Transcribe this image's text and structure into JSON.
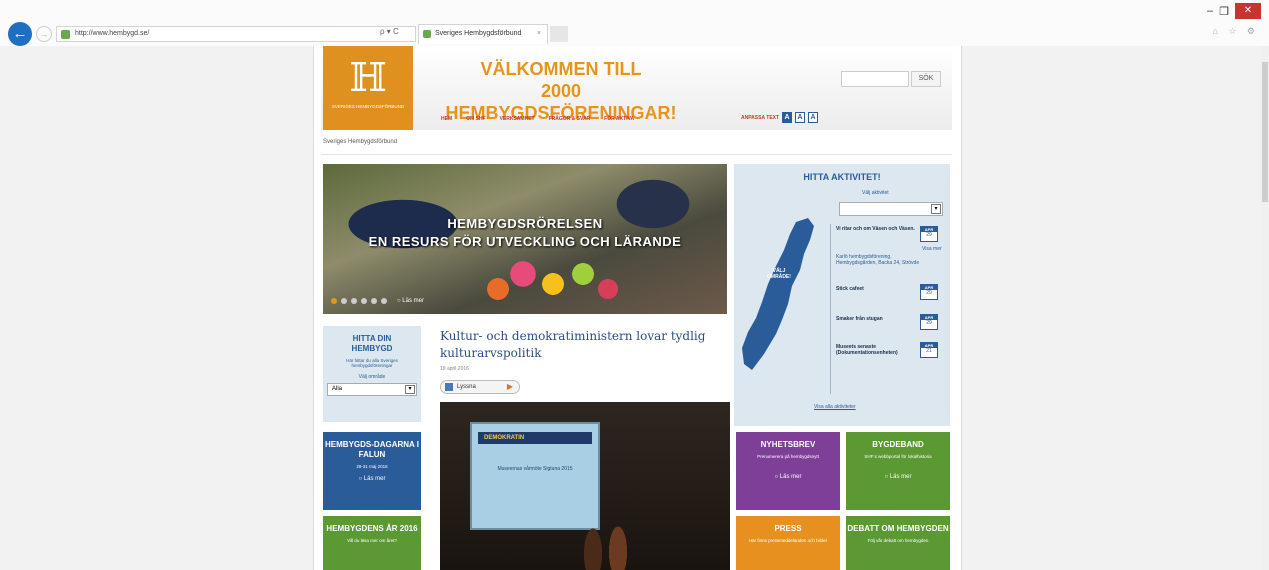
{
  "browser": {
    "url": "http://www.hembygd.se/",
    "tab_title": "Sveriges Hembygdsförbund",
    "tab_close": "×",
    "addr_tools": "ρ ▾ C",
    "window_controls": [
      "–",
      "❐",
      "✕"
    ],
    "side_icons": "⌂ ☆ ⚙"
  },
  "header": {
    "logo_text": "SVERIGES HEMBYGDSFÖRBUND",
    "welcome_line1": "VÄLKOMMEN TILL",
    "welcome_line2": "2000 HEMBYGDSFÖRENINGAR!",
    "search_button": "SÖK",
    "nav": [
      "HEM",
      "OM SHF",
      "VERKSAMHET",
      "FRÅGOR & SVAR",
      "FÖR AKTIVA"
    ],
    "textsize_label": "ANPASSA TEXT",
    "textsize_options": [
      "A",
      "A",
      "A"
    ]
  },
  "breadcrumb": "Sveriges Hembygdsförbund",
  "hero": {
    "caption_line1": "HEMBYGDSRÖRELSEN",
    "caption_line2": "EN RESURS FÖR UTVECKLING OCH LÄRANDE",
    "read_more": "○ Läs mer"
  },
  "aktivitet": {
    "title": "HITTA AKTIVITET!",
    "sub": "Välj aktivitet",
    "map_label": "VÄLJ OMRÅDE!",
    "events": [
      {
        "title": "Vi ritar och om Väsen och Väsen.",
        "month": "APR",
        "day": "29"
      },
      {
        "title": "Stick cafeet",
        "month": "APR",
        "day": "29"
      },
      {
        "title": "Smaker från stugan",
        "month": "APR",
        "day": "29"
      },
      {
        "title": "Museets senaste (Dokumentationsenheten)",
        "month": "APR",
        "day": "21"
      }
    ],
    "event_note": "Visa mer",
    "event_place": "Karlö hembygdsförening, Hembygdsgården, Backa 24, Strövde",
    "all_link": "Visa alla aktiviteter"
  },
  "hitta_din": {
    "title_line1": "HITTA DIN",
    "title_line2": "HEMBYGD",
    "desc": "Här hittar du alla Sveriges hembygdsföreningar",
    "valj": "Välj område",
    "select_value": "Alla"
  },
  "article": {
    "title": "Kultur- och demokratiministern lovar tydlig kulturarvspolitik",
    "date": "19 april 2016",
    "listen": "Lyssna",
    "slide_title": "DEMOKRATIN",
    "slide_text": "Museernas vårmöte Sigtuna 2015"
  },
  "tiles": {
    "hembygdsdagarna": {
      "title": "HEMBYGDS-DAGARNA I FALUN",
      "date": "29-31 maj 2016",
      "more": "○ Läs mer"
    },
    "hembygdens_ar": {
      "title": "HEMBYGDENS ÅR 2016",
      "desc": "Vill du läsa mer om året?"
    },
    "nyhetsbrev": {
      "title": "NYHETSBREV",
      "desc": "Prenumerera på hembygdsnytt",
      "more": "○ Läs mer"
    },
    "bygdeband": {
      "title": "BYGDEBAND",
      "desc": "SHF:s webbportal för lokalhistoria",
      "more": "○ Läs mer"
    },
    "press": {
      "title": "PRESS",
      "desc": "Här finns pressmeddelanden och bilder"
    },
    "debatt": {
      "title": "DEBATT OM HEMBYGDEN",
      "desc": "Följ vår debatt om hembygden"
    }
  }
}
